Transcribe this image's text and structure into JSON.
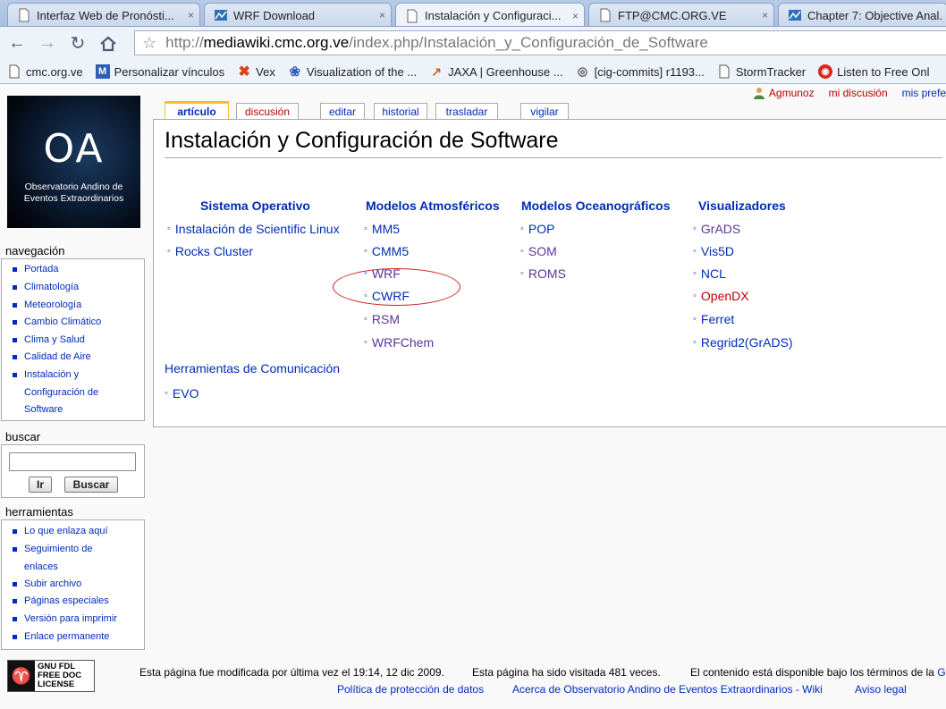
{
  "browser": {
    "tabs": [
      {
        "label": "Interfaz Web de Pronósti...",
        "close": "×",
        "active": false
      },
      {
        "label": "WRF Download",
        "close": "×",
        "active": false
      },
      {
        "label": "Instalación y Configuraci...",
        "close": "×",
        "active": true
      },
      {
        "label": "FTP@CMC.ORG.VE",
        "close": "×",
        "active": false
      },
      {
        "label": "Chapter 7: Objective Anal...",
        "close": "",
        "active": false
      }
    ],
    "url_prefix": "http://",
    "url_host": "mediawiki.cmc.org.ve",
    "url_path": "/index.php/Instalación_y_Configuración_de_Software",
    "bookmarks": [
      {
        "label": "cmc.org.ve",
        "icon": "page-icon"
      },
      {
        "label": "Personalizar vínculos",
        "icon": "m-icon"
      },
      {
        "label": "Vex",
        "icon": "x-icon"
      },
      {
        "label": "Visualization of the ...",
        "icon": "globe-icon"
      },
      {
        "label": "JAXA | Greenhouse ...",
        "icon": "rocket-icon"
      },
      {
        "label": "[cig-commits] r1193...",
        "icon": "circle-icon"
      },
      {
        "label": "StormTracker",
        "icon": "page-icon"
      },
      {
        "label": "Listen to Free Onl",
        "icon": "radio-icon"
      }
    ]
  },
  "logo": {
    "mark": "OA",
    "line1": "Observatorio Andino de",
    "line2": "Eventos Extraordinarios"
  },
  "user_tools": {
    "username": "Agmunoz",
    "talk": "mi discusión",
    "prefs": "mis prefe"
  },
  "page_tabs": {
    "article": "artículo",
    "discussion": "discusión",
    "edit": "editar",
    "history": "historial",
    "move": "trasladar",
    "watch": "vigilar"
  },
  "article": {
    "title": "Instalación y Configuración de Software",
    "columns": [
      {
        "title": "Sistema Operativo",
        "items": [
          "Instalación de Scientific Linux",
          "Rocks Cluster"
        ]
      },
      {
        "title": "Modelos Atmosféricos",
        "items": [
          "MM5",
          "CMM5",
          "WRF",
          "CWRF",
          "RSM",
          "WRFChem"
        ]
      },
      {
        "title": "Modelos Oceanográficos",
        "items": [
          "POP",
          "SOM",
          "ROMS"
        ]
      },
      {
        "title": "Visualizadores",
        "items": [
          "GrADS",
          "Vis5D",
          "NCL",
          "OpenDX",
          "Ferret",
          "Regrid2(GrADS)"
        ]
      }
    ],
    "herramientas_title": "Herramientas de Comunicación",
    "herramientas_items": [
      "EVO"
    ]
  },
  "sidebar": {
    "navigation_title": "navegación",
    "navigation": [
      "Portada",
      "Climatología",
      "Meteorología",
      "Cambio Climático",
      "Clima y Salud",
      "Calidad de Aire",
      "Instalación y Configuración de Software"
    ],
    "search_title": "buscar",
    "search_value": "",
    "go_button": "Ir",
    "search_button": "Buscar",
    "tools_title": "herramientas",
    "tools": [
      "Lo que enlaza aquí",
      "Seguimiento de enlaces",
      "Subir archivo",
      "Páginas especiales",
      "Versión para imprimir",
      "Enlace permanente"
    ]
  },
  "footer": {
    "badge_line1": "GNU FDL",
    "badge_line2": "FREE DOC",
    "badge_line3": "LICENSE",
    "modified": "Esta página fue modificada por última vez el 19:14, 12 dic 2009.",
    "visits": "Esta página ha sido visitada 481 veces.",
    "license_prefix": "El contenido está disponible bajo los términos de la",
    "license_link": "GN",
    "privacy": "Política de protección de datos",
    "about": "Acerca de Observatorio Andino de Eventos Extraordinarios - Wiki",
    "disclaimer": "Aviso legal"
  },
  "colors": {
    "link": "#002bb8",
    "visited": "#5a3696",
    "new_link": "#ba0000",
    "selected_tab": "#fabd23",
    "annotation_circle": "#d02020"
  }
}
